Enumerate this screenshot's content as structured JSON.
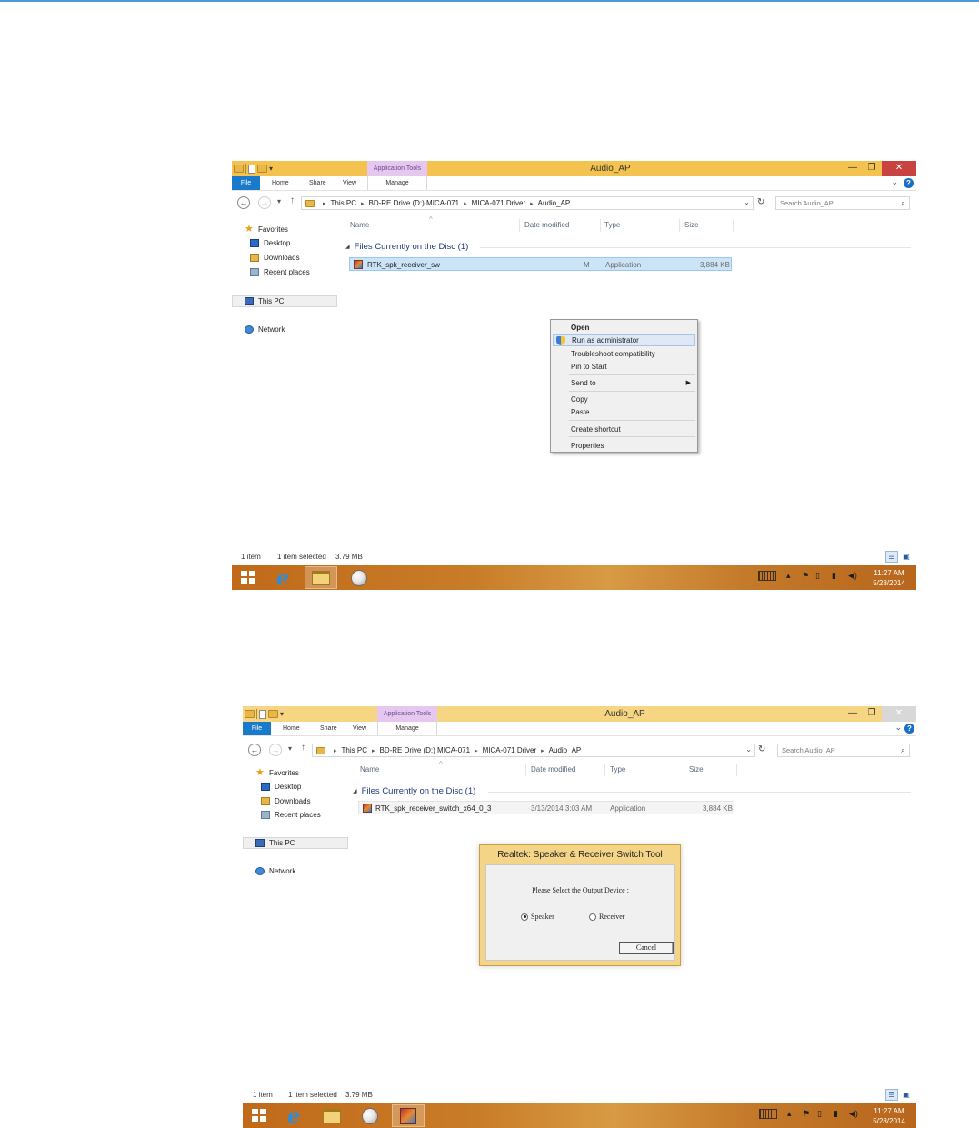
{
  "windows": [
    {
      "quick_access_arrow": "▾",
      "tool_tab": "Application Tools",
      "title": "Audio_AP",
      "ribbon_tabs": [
        "File",
        "Home",
        "Share",
        "View",
        "Manage"
      ],
      "address": [
        "This PC",
        "BD-RE Drive (D:) MICA-071",
        "MICA-071 Driver",
        "Audio_AP"
      ],
      "search_placeholder": "Search Audio_AP",
      "nav": {
        "favorites": "Favorites",
        "desktop": "Desktop",
        "downloads": "Downloads",
        "recent": "Recent places",
        "this_pc": "This PC",
        "network": "Network"
      },
      "columns": [
        "Name",
        "Date modified",
        "Type",
        "Size"
      ],
      "group": "Files Currently on the Disc (1)",
      "file": {
        "name": "RTK_spk_receiver_sw",
        "date": "M",
        "type": "Application",
        "size": "3,884 KB"
      },
      "context_menu": [
        "Open",
        "Run as administrator",
        "Troubleshoot compatibility",
        "Pin to Start",
        "Send to",
        "Copy",
        "Paste",
        "Create shortcut",
        "Properties"
      ],
      "status": {
        "items": "1 item",
        "selected": "1 item selected",
        "size": "3.79 MB"
      },
      "clock": {
        "time": "11:27 AM",
        "date": "5/28/2014"
      }
    },
    {
      "quick_access_arrow": "▾",
      "tool_tab": "Application Tools",
      "title": "Audio_AP",
      "ribbon_tabs": [
        "File",
        "Home",
        "Share",
        "View",
        "Manage"
      ],
      "address": [
        "This PC",
        "BD-RE Drive (D:) MICA-071",
        "MICA-071 Driver",
        "Audio_AP"
      ],
      "search_placeholder": "Search Audio_AP",
      "nav": {
        "favorites": "Favorites",
        "desktop": "Desktop",
        "downloads": "Downloads",
        "recent": "Recent places",
        "this_pc": "This PC",
        "network": "Network"
      },
      "columns": [
        "Name",
        "Date modified",
        "Type",
        "Size"
      ],
      "group": "Files Currently on the Disc (1)",
      "file": {
        "name": "RTK_spk_receiver_switch_x64_0_3",
        "date": "3/13/2014 3:03 AM",
        "type": "Application",
        "size": "3,884 KB"
      },
      "dialog": {
        "title": "Realtek: Speaker & Receiver Switch Tool",
        "prompt": "Please Select the Output Device :",
        "option_speaker": "Speaker",
        "option_receiver": "Receiver",
        "selected": "Speaker",
        "cancel": "Cancel"
      },
      "status": {
        "items": "1 item",
        "selected": "1 item selected",
        "size": "3.79 MB"
      },
      "clock": {
        "time": "11:27 AM",
        "date": "5/28/2014"
      }
    }
  ]
}
